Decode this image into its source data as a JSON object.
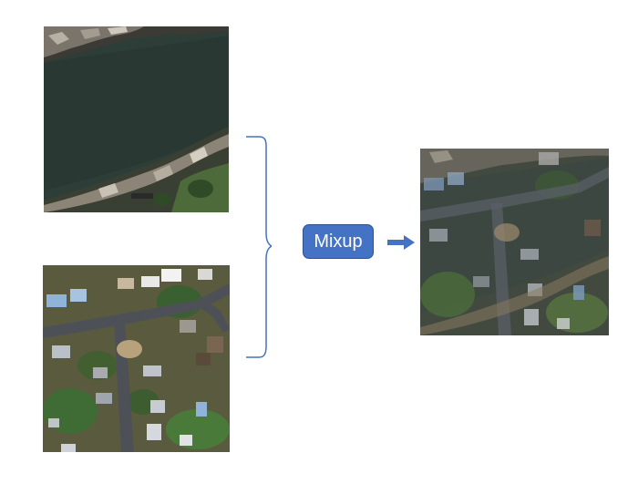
{
  "diagram": {
    "operation_label": "Mixup",
    "inputs": [
      {
        "icon": "river-aerial-image"
      },
      {
        "icon": "suburb-aerial-image"
      }
    ],
    "output": {
      "icon": "mixed-aerial-image"
    }
  },
  "colors": {
    "button_fill": "#4472c4",
    "button_text": "#ffffff",
    "brace_stroke": "#4472c4",
    "arrow_fill": "#4472c4",
    "water": "#2b3a36",
    "vegetation": "#3f6b35",
    "road": "#4d5157",
    "roof": "#8fb3d9"
  }
}
